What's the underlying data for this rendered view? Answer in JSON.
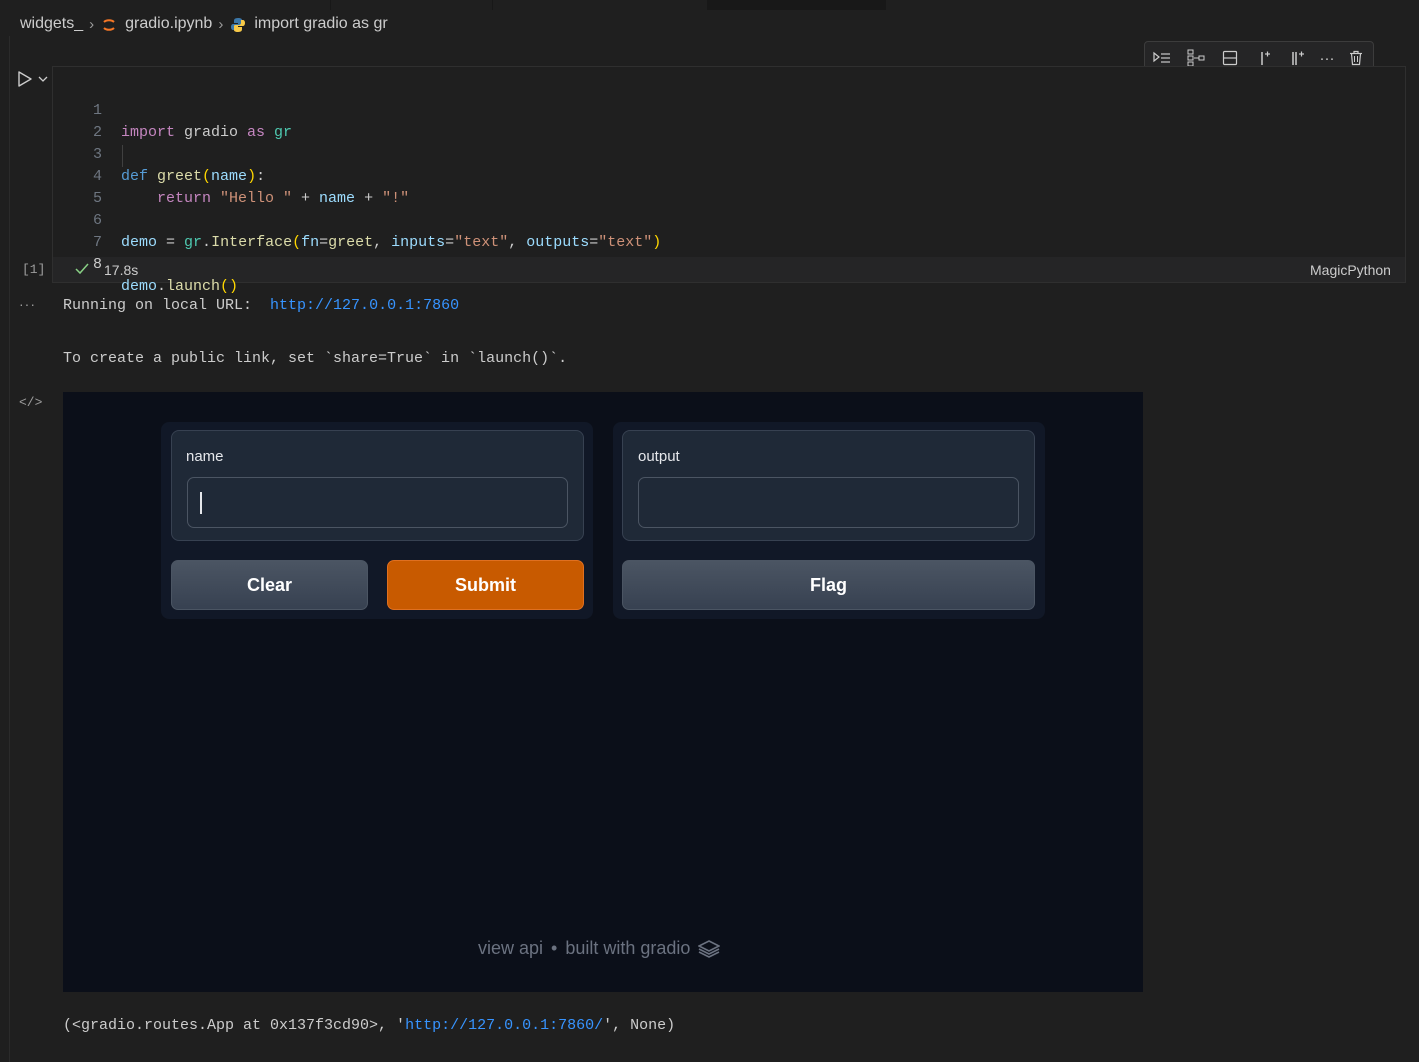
{
  "breadcrumb": {
    "items": [
      "widgets_",
      "gradio.ipynb",
      "import gradio as gr"
    ]
  },
  "toolbar": {
    "more_label": "···"
  },
  "cell": {
    "line_numbers": [
      "1",
      "2",
      "3",
      "4",
      "5",
      "6",
      "7",
      "8"
    ],
    "code": {
      "l1_import": "import",
      "l1_mod": " gradio ",
      "l1_as": "as",
      "l1_alias": " gr",
      "l3_def": "def",
      "l3_fn": " greet",
      "l3_open": "(",
      "l3_param": "name",
      "l3_close": ")",
      "l3_colon": ":",
      "l4_return": "    return",
      "l4_s1": " \"Hello \"",
      "l4_plus1": " + ",
      "l4_name": "name",
      "l4_plus2": " + ",
      "l4_s2": "\"!\"",
      "l6_demo": "demo",
      "l6_eq": " = ",
      "l6_gr": "gr",
      "l6_dot": ".",
      "l6_iface": "Interface",
      "l6_open": "(",
      "l6_fn": "fn",
      "l6_eq2": "=",
      "l6_greet": "greet",
      "l6_comma1": ", ",
      "l6_inputs": "inputs",
      "l6_eq3": "=",
      "l6_text1": "\"text\"",
      "l6_comma2": ", ",
      "l6_outputs": "outputs",
      "l6_eq4": "=",
      "l6_text2": "\"text\"",
      "l6_close": ")",
      "l8_demo": "demo",
      "l8_dot": ".",
      "l8_launch": "launch",
      "l8_parens": "()"
    },
    "execution_count": "[1]",
    "duration": "17.8s",
    "language": "MagicPython"
  },
  "output": {
    "ellipsis": "···",
    "line1_prefix": "Running on local URL:  ",
    "line1_url": "http://127.0.0.1:7860",
    "line2": "To create a public link, set `share=True` in `launch()`.",
    "html_icon": "</>",
    "line3_prefix": "(<gradio.routes.App at 0x137f3cd90>, '",
    "line3_url": "http://127.0.0.1:7860/",
    "line3_suffix": "', None)"
  },
  "gradio": {
    "input_label": "name",
    "input_value": "",
    "output_label": "output",
    "output_value": "",
    "clear_label": "Clear",
    "submit_label": "Submit",
    "flag_label": "Flag",
    "footer_api": "view api",
    "footer_dot": "•",
    "footer_built": "built with gradio"
  },
  "colors": {
    "submit": "#c85a00",
    "link": "#3794ff",
    "background": "#1f1f1f",
    "gradio_bg": "#0b0f19"
  }
}
